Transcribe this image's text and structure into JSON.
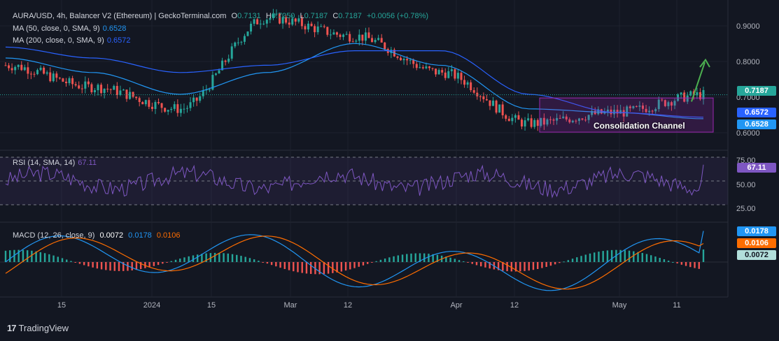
{
  "header": {
    "symbol": "AURA/USD, 4h, Balancer V2 (Ethereum) | GeckoTerminal.com",
    "o_label": "O",
    "o_value": "0.7131",
    "h_label": "H",
    "h_value": "0.7250",
    "l_label": "L",
    "l_value": "0.7187",
    "c_label": "C",
    "c_value": "0.7187",
    "change": "+0.0056 (+0.78%)",
    "ma50_label": "MA (50, close, 0, SMA, 9)",
    "ma50_value": "0.6528",
    "ma200_label": "MA (200, close, 0, SMA, 9)",
    "ma200_value": "0.6572"
  },
  "price_axis": [
    "0.9000",
    "0.8000",
    "0.7000",
    "0.6000"
  ],
  "price_badges": {
    "last": "0.7187",
    "ma200": "0.6572",
    "ma50": "0.6528"
  },
  "annotation": "Consolidation Channel",
  "rsi": {
    "label": "RSI (14, SMA, 14)",
    "value": "67.11",
    "axis": [
      "75.00",
      "50.00",
      "25.00"
    ]
  },
  "macd": {
    "label": "MACD (12, 26, close, 9)",
    "hist": "0.0072",
    "macd": "0.0178",
    "signal": "0.0106"
  },
  "x_axis": [
    "15",
    "2024",
    "15",
    "Mar",
    "12",
    "Apr",
    "12",
    "May",
    "11"
  ],
  "branding": "TradingView",
  "colors": {
    "up": "#26a69a",
    "down": "#ef5350",
    "ma50": "#2196f3",
    "ma200": "#2962ff",
    "rsi": "#7e57c2",
    "macd": "#2196f3",
    "signal": "#ff6d00",
    "arrow": "#4caf50"
  },
  "chart_data": {
    "type": "line",
    "x": [
      "Jan 15",
      "2024",
      "Feb 15",
      "Mar",
      "Mar 12",
      "Apr",
      "Apr 12",
      "May",
      "May 11"
    ],
    "series": [
      {
        "name": "AURA/USD close",
        "values": [
          0.8,
          0.74,
          0.68,
          0.93,
          0.88,
          0.78,
          0.64,
          0.67,
          0.7187
        ]
      },
      {
        "name": "MA (50, close, 0, SMA, 9)",
        "values": [
          0.82,
          0.78,
          0.72,
          0.78,
          0.86,
          0.8,
          0.68,
          0.67,
          0.6528
        ]
      },
      {
        "name": "MA (200, close, 0, SMA, 9)",
        "values": [
          0.85,
          0.82,
          0.78,
          0.8,
          0.84,
          0.84,
          0.72,
          0.67,
          0.6572
        ]
      }
    ],
    "ylim": [
      0.57,
      0.97
    ],
    "rsi_last": 67.11,
    "macd_last": {
      "macd": 0.0178,
      "signal": 0.0106,
      "hist": 0.0072
    }
  }
}
